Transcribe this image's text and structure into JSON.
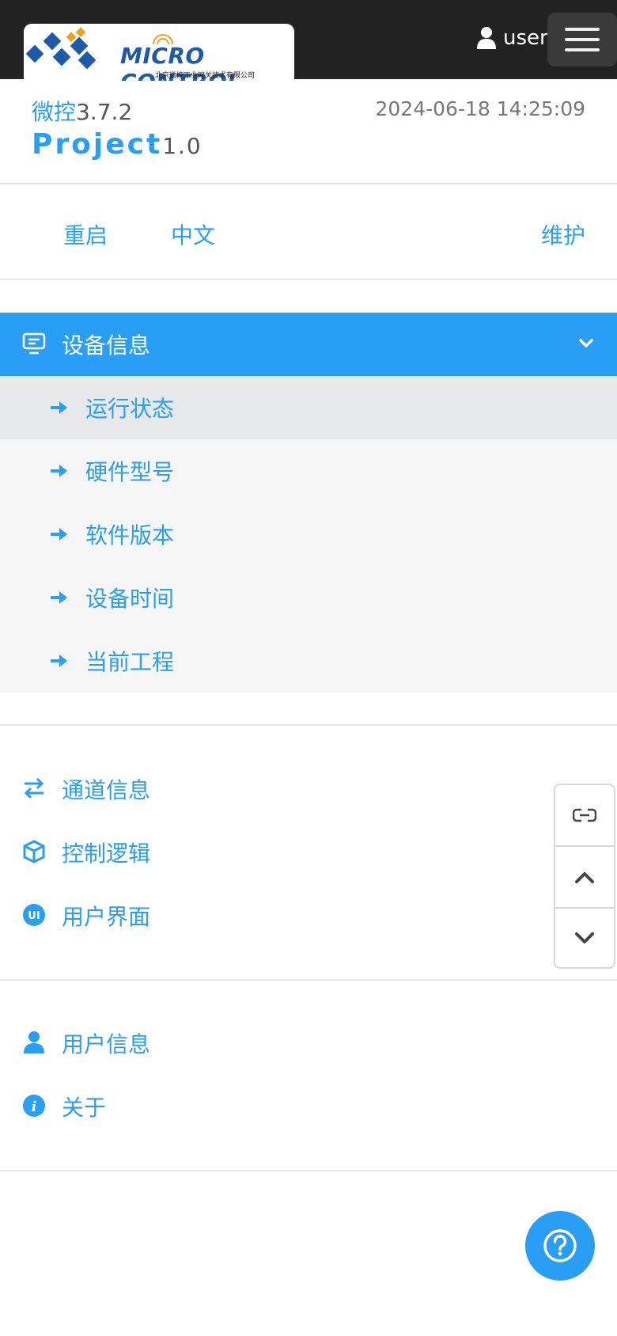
{
  "header": {
    "logo": {
      "title": "MICRO CONTROL",
      "subtitle": "北京微控工业网关技术有限公司",
      "colors": {
        "blue": "#1e5aa8",
        "orange": "#f0a020"
      }
    },
    "user_label": "user",
    "menu_icon": "hamburger-icon"
  },
  "info": {
    "product_name": "微控",
    "product_version": "3.7.2",
    "datetime": "2024-06-18 14:25:09",
    "project_name": "Project",
    "project_version": "1.0"
  },
  "actions": {
    "restart": "重启",
    "language": "中文",
    "maintenance": "维护"
  },
  "menu": {
    "device_info": {
      "label": "设备信息",
      "icon": "monitor-chat-icon",
      "expanded": true,
      "items": [
        {
          "label": "运行状态",
          "active": true
        },
        {
          "label": "硬件型号",
          "active": false
        },
        {
          "label": "软件版本",
          "active": false
        },
        {
          "label": "设备时间",
          "active": false
        },
        {
          "label": "当前工程",
          "active": false
        }
      ]
    },
    "group2": [
      {
        "label": "通道信息",
        "icon": "exchange-arrows-icon"
      },
      {
        "label": "控制逻辑",
        "icon": "cube-icon"
      },
      {
        "label": "用户界面",
        "icon": "ui-badge-icon"
      }
    ],
    "group3": [
      {
        "label": "用户信息",
        "icon": "user-icon"
      },
      {
        "label": "关于",
        "icon": "info-icon"
      }
    ]
  },
  "side_tools": [
    "link-icon",
    "chevron-up-icon",
    "chevron-down-icon"
  ],
  "help_button_icon": "question-icon",
  "colors": {
    "accent": "#2a9df4",
    "topbar": "#222222",
    "active_row": "#e6e8ea",
    "submenu_bg": "#f6f6f6"
  }
}
